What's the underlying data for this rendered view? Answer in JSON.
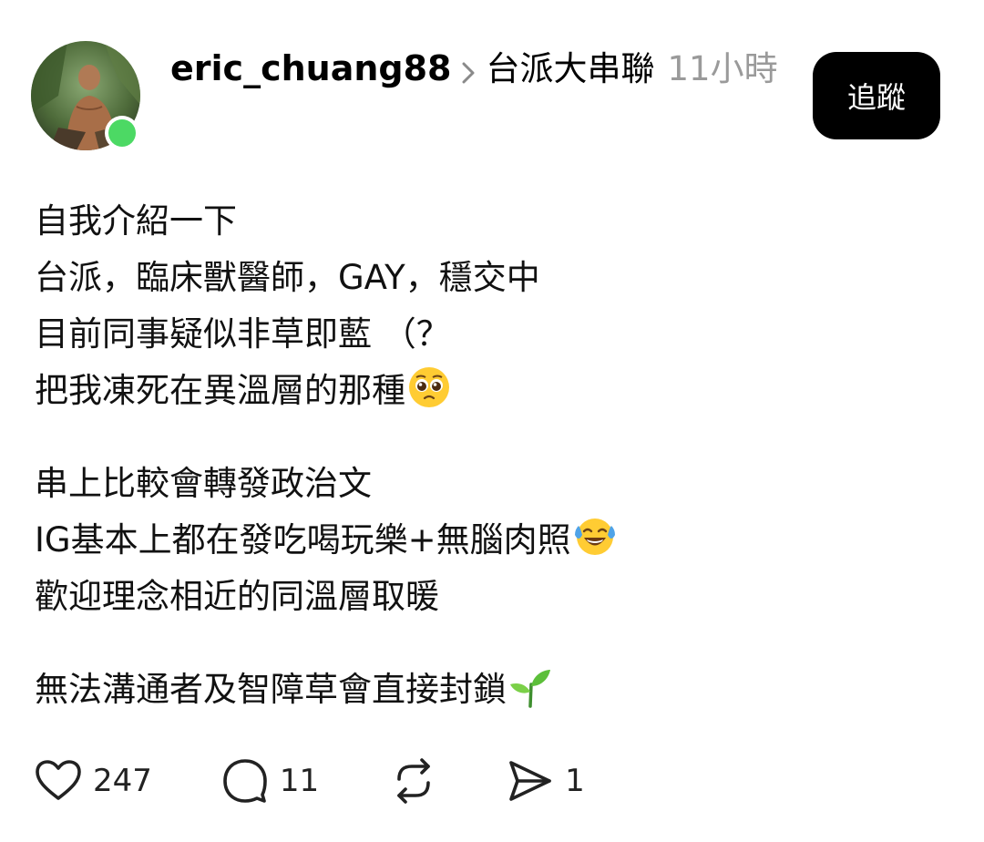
{
  "colors": {
    "online": "#4cd964",
    "follow_bg": "#000000",
    "follow_text": "#ffffff",
    "muted": "#9a9a9a"
  },
  "header": {
    "username": "eric_chuang88",
    "community": "台派大串聯",
    "time": "11小時"
  },
  "follow_button": {
    "label": "追蹤"
  },
  "post": {
    "paragraphs": [
      [
        "自我介紹一下",
        "台派，臨床獸醫師，GAY，穩交中",
        "目前同事疑似非草即藍 （？",
        "把我凍死在異溫層的那種"
      ],
      [
        "串上比較會轉發政治文",
        "IG基本上都在發吃喝玩樂+無腦肉照",
        "歡迎理念相近的同溫層取暖"
      ],
      [
        "無法溝通者及智障草會直接封鎖"
      ]
    ],
    "emojis": {
      "p0_l3": "pleading-face-emoji",
      "p1_l1": "tears-of-joy-emoji",
      "p2_l0": "seedling-emoji"
    }
  },
  "actions": {
    "likes": "247",
    "comments": "11",
    "shares": "1",
    "icons": [
      "heart-icon",
      "comment-icon",
      "repost-icon",
      "send-icon"
    ]
  }
}
